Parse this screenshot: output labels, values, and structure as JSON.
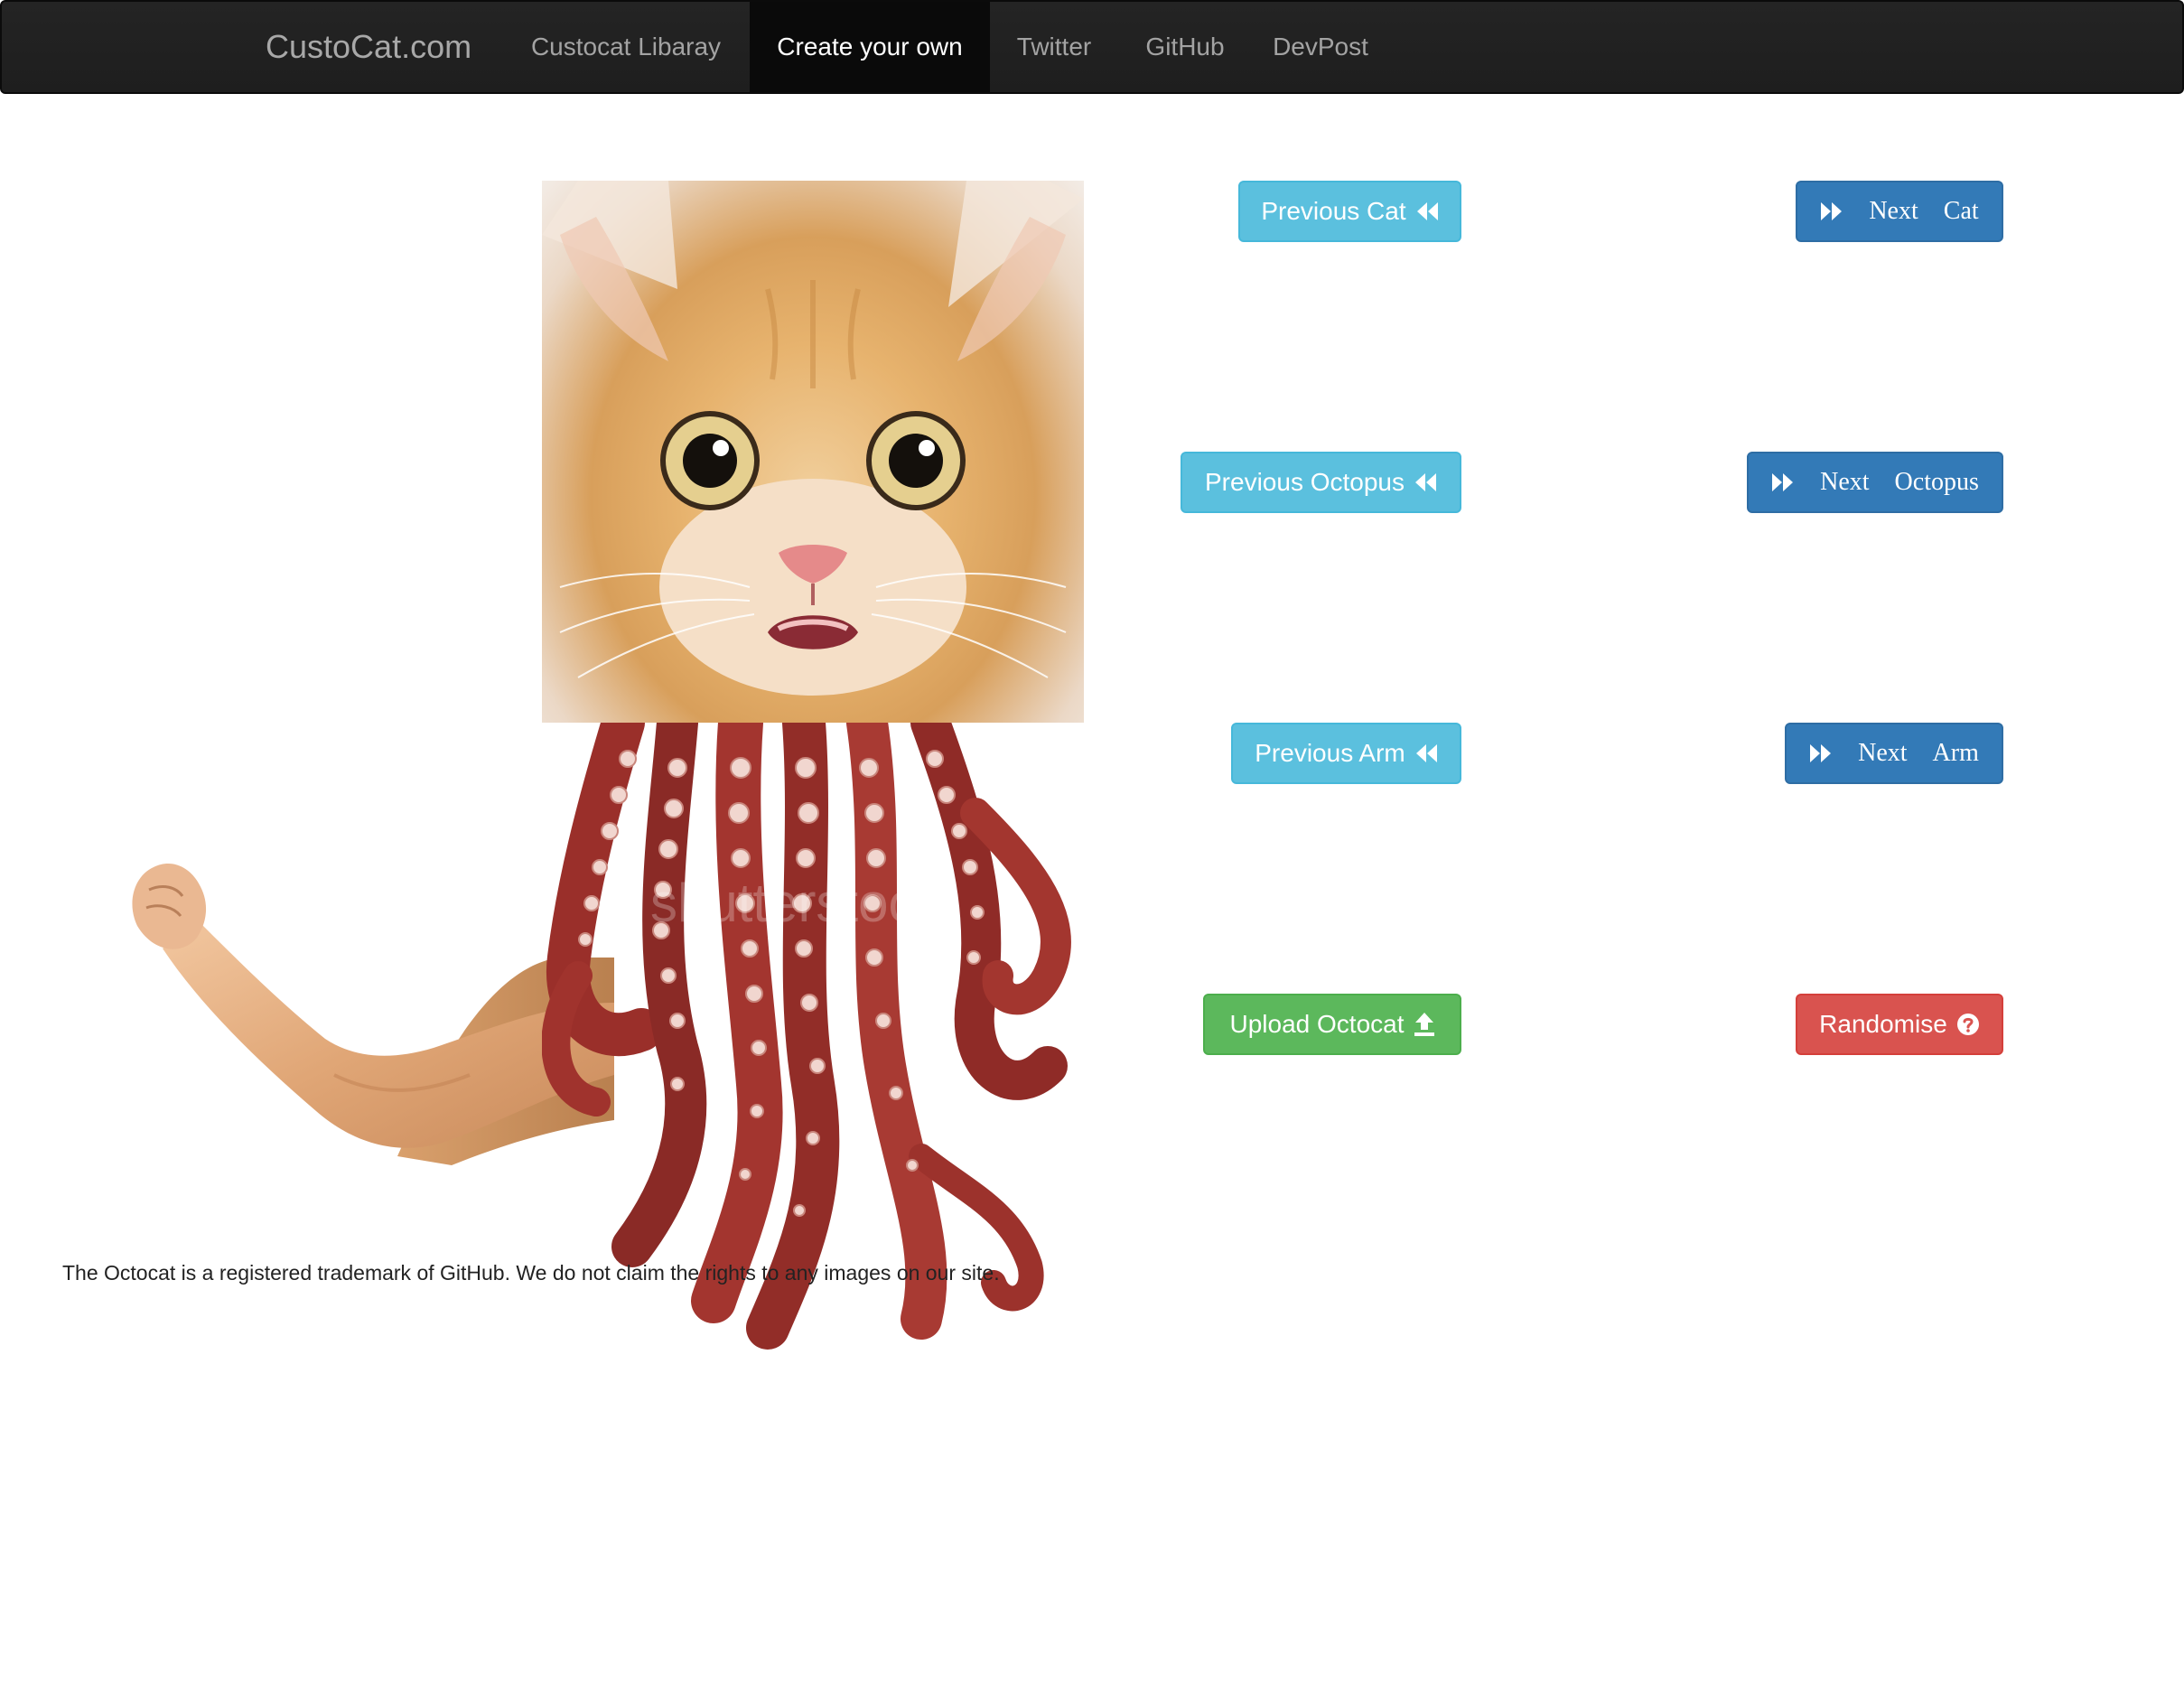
{
  "navbar": {
    "brand": "CustoCat.com",
    "links": [
      {
        "label": "Custocat Libaray",
        "active": false
      },
      {
        "label": "Create your own",
        "active": true
      },
      {
        "label": "Twitter",
        "active": false
      },
      {
        "label": "GitHub",
        "active": false
      },
      {
        "label": "DevPost",
        "active": false
      }
    ]
  },
  "composite": {
    "parts": [
      "cat-face",
      "arm",
      "octopus-tentacles"
    ],
    "watermark": "shutterstock"
  },
  "controls": {
    "previous_cat": {
      "label": "Previous Cat",
      "icon": "backward-icon"
    },
    "next_cat": {
      "word1": "Next",
      "word2": "Cat",
      "icon": "forward-icon"
    },
    "previous_octopus": {
      "label": "Previous Octopus",
      "icon": "backward-icon"
    },
    "next_octopus": {
      "word1": "Next",
      "word2": "Octopus",
      "icon": "forward-icon"
    },
    "previous_arm": {
      "label": "Previous Arm",
      "icon": "backward-icon"
    },
    "next_arm": {
      "word1": "Next",
      "word2": "Arm",
      "icon": "forward-icon"
    },
    "upload": {
      "label": "Upload Octocat",
      "icon": "upload-icon"
    },
    "randomise": {
      "label": "Randomise",
      "icon": "question-circle-icon"
    }
  },
  "colors": {
    "info": "#5bc0de",
    "primary": "#337ab7",
    "success": "#5cb85c",
    "danger": "#d9534f",
    "navbar": "#222222"
  },
  "footer": {
    "note": "The Octocat is a registered trademark of GitHub. We do not claim the rights to any images on our site."
  }
}
